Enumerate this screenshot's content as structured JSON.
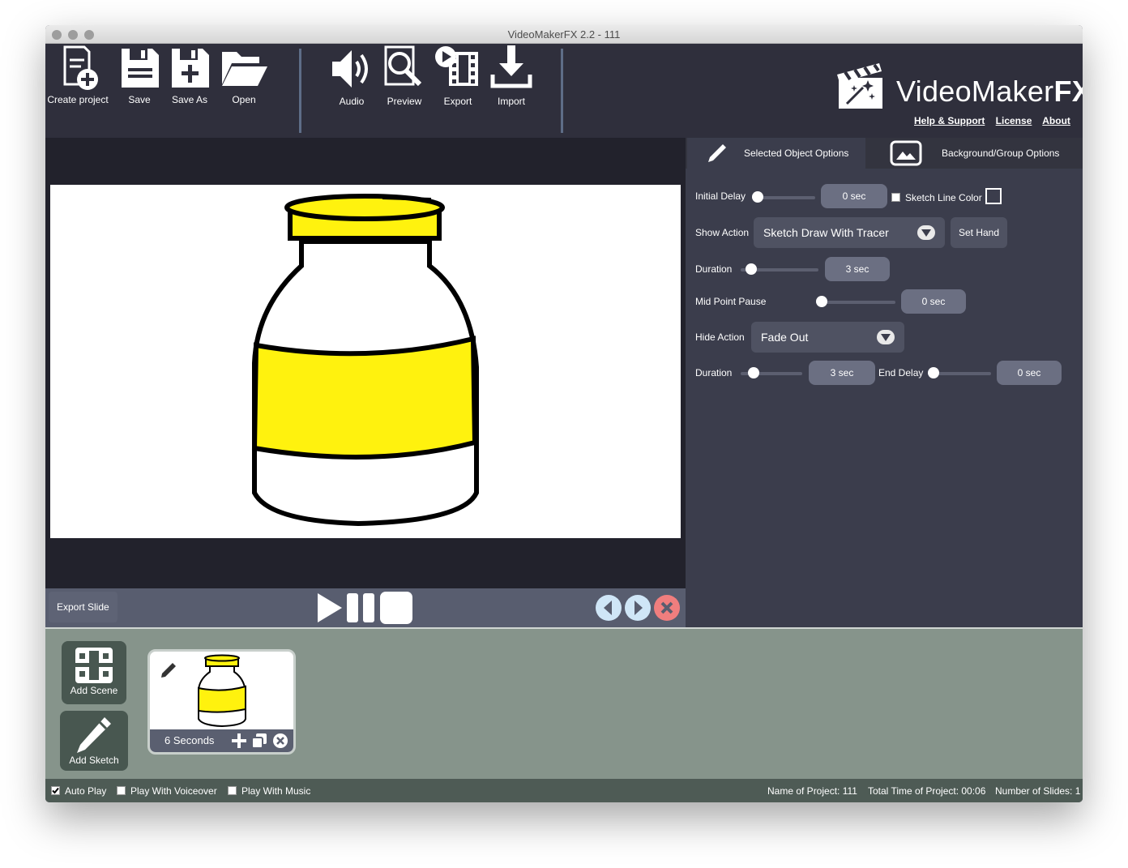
{
  "window": {
    "title": "VideoMakerFX 2.2 - 111"
  },
  "toolbar": {
    "create_project": "Create project",
    "save": "Save",
    "save_as": "Save As",
    "open": "Open",
    "audio": "Audio",
    "preview": "Preview",
    "export": "Export",
    "import": "Import"
  },
  "brand": {
    "name_light": "VideoMaker",
    "name_bold": "FX",
    "links": {
      "help": "Help & Support",
      "license": "License",
      "about": "About"
    }
  },
  "player": {
    "export_slide": "Export Slide"
  },
  "panel": {
    "tabs": {
      "selected": "Selected Object Options",
      "background": "Background/Group Options"
    },
    "initial_delay": {
      "label": "Initial Delay",
      "value": "0 sec",
      "level": 0
    },
    "sketch_line_color": {
      "label": "Sketch Line Color",
      "checked": false
    },
    "show_action": {
      "label": "Show Action",
      "value": "Sketch Draw With Tracer"
    },
    "set_hand": "Set Hand",
    "duration1": {
      "label": "Duration",
      "value": "3 sec",
      "level": 0.05
    },
    "mid_point_pause": {
      "label": "Mid Point Pause",
      "value": "0 sec",
      "level": 0
    },
    "hide_action": {
      "label": "Hide Action",
      "value": "Fade Out"
    },
    "duration2": {
      "label": "Duration",
      "value": "3 sec",
      "level": 0.05
    },
    "end_delay": {
      "label": "End Delay",
      "value": "0 sec",
      "level": 0
    }
  },
  "bottom": {
    "add_scene": "Add Scene",
    "add_sketch": "Add Sketch",
    "slide": {
      "duration": "6 Seconds"
    }
  },
  "status": {
    "auto_play": {
      "label": "Auto Play",
      "checked": true
    },
    "play_with_voiceover": {
      "label": "Play With Voiceover",
      "checked": false
    },
    "play_with_music": {
      "label": "Play With Music",
      "checked": false
    },
    "project_name": "Name of Project: 111",
    "total_time": "Total Time of Project: 00:06",
    "slide_count": "Number of Slides: 1"
  },
  "colors": {
    "jar_yellow": "#fff20e",
    "toolbar_bg": "#2f2f3c",
    "panel_bg": "#3b3d4c",
    "bottom_bg": "#86948b",
    "nav_blue": "#cfe6f7",
    "close_red": "#f07e7e"
  }
}
